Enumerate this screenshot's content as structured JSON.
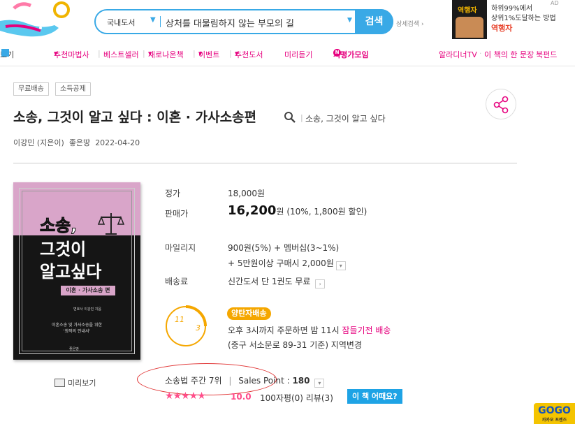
{
  "search": {
    "category": "국내도서",
    "query": "상처를 대물림하지 않는 부모의 길",
    "button": "검색",
    "detail": "상세검색"
  },
  "ad": {
    "book_tag": "역행자",
    "line1": "하위99%에서",
    "line2": "상위1%도달하는 방법",
    "title": "역행자",
    "mark": "AD"
  },
  "nav": {
    "items": [
      "보기",
      "추천마법사",
      "베스트셀러",
      "새로나온책",
      "이벤트",
      "추천도서",
      "미리듣기",
      "서평가모임"
    ],
    "right": [
      "알라디너TV",
      "이 책의 한 문장",
      "북펀드"
    ]
  },
  "badges": [
    "무료배송",
    "소득공제"
  ],
  "book": {
    "title": "소송, 그것이 알고 싶다 : 이혼 · 가사소송편",
    "series": "소송, 그것이 알고 싶다",
    "author": "이강민 (지은이)",
    "publisher": "좋은땅",
    "date": "2022-04-20",
    "cover_title": [
      "소송,",
      "그것이",
      "알고싶다"
    ],
    "cover_subtitle": "이혼 · 가사소송 편",
    "cover_author": "변호사 이강민 지음",
    "cover_blurb": "이혼소송 및 가사소송을 위한\n'최적의 안내서'",
    "cover_publisher": "좋은땅",
    "preview": "미리보기"
  },
  "price": {
    "list_label": "정가",
    "list_price": "18,000원",
    "sale_label": "판매가",
    "sale_price": "16,200",
    "sale_unit": "원",
    "discount": "(10%, 1,800원 할인)",
    "mileage_label": "마일리지",
    "mileage1": "900원(5%) + 멤버십(3~1%)",
    "mileage2": "+ 5만원이상 구매시 2,000원",
    "shipping_label": "배송료",
    "shipping": "신간도서 단 1권도 무료"
  },
  "delivery": {
    "pill": "양탄자배송",
    "line1_a": "오후 3시까지 주문하면 밤 11시 ",
    "line1_b": "잠들기전 배송",
    "line2": "(중구 서소문로 89-31 기준) 지역변경",
    "clock_left": "11",
    "clock_right": "3"
  },
  "sales": {
    "rank": "소송법 주간 7위",
    "sep": "|",
    "point_label": "Sales Point : ",
    "point_value": "180"
  },
  "review": {
    "stars": "★★★★★",
    "score": "10.0",
    "text": "100자평(0)  리뷰(3)",
    "button": "이 책 어때요?"
  },
  "gogo": {
    "title": "GOGO",
    "sub": "카카오 프렌즈"
  },
  "colors": {
    "accent": "#39a9e6",
    "pink": "#e6007e",
    "orange": "#f5a700"
  }
}
